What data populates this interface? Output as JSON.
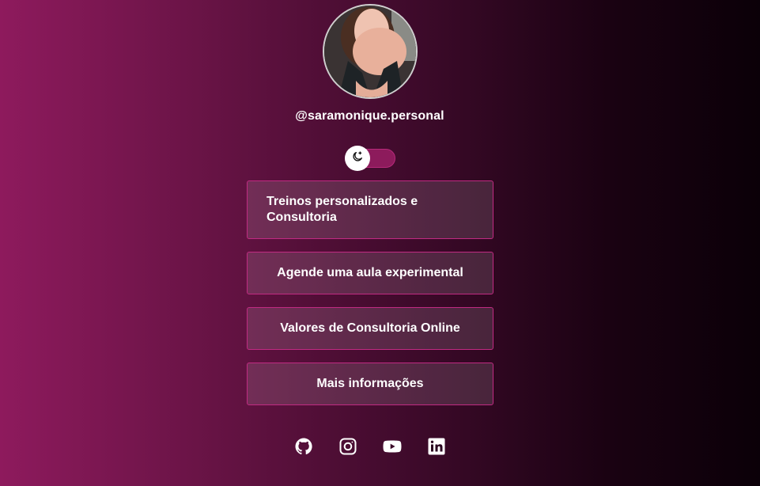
{
  "profile": {
    "username": "@saramonique.personal"
  },
  "theme_toggle": {
    "icon": "moon-icon"
  },
  "links": [
    {
      "label": "Treinos personalizados e Consultoria"
    },
    {
      "label": "Agende uma aula experimental"
    },
    {
      "label": "Valores de Consultoria Online"
    },
    {
      "label": "Mais informações"
    }
  ],
  "social": [
    {
      "icon": "github-icon"
    },
    {
      "icon": "instagram-icon"
    },
    {
      "icon": "youtube-icon"
    },
    {
      "icon": "linkedin-icon"
    }
  ],
  "colors": {
    "background_left": "#8e1a5d",
    "background_right": "#0b0008",
    "button_border": "#c02a82",
    "toggle_track": "#8d1b5c"
  }
}
